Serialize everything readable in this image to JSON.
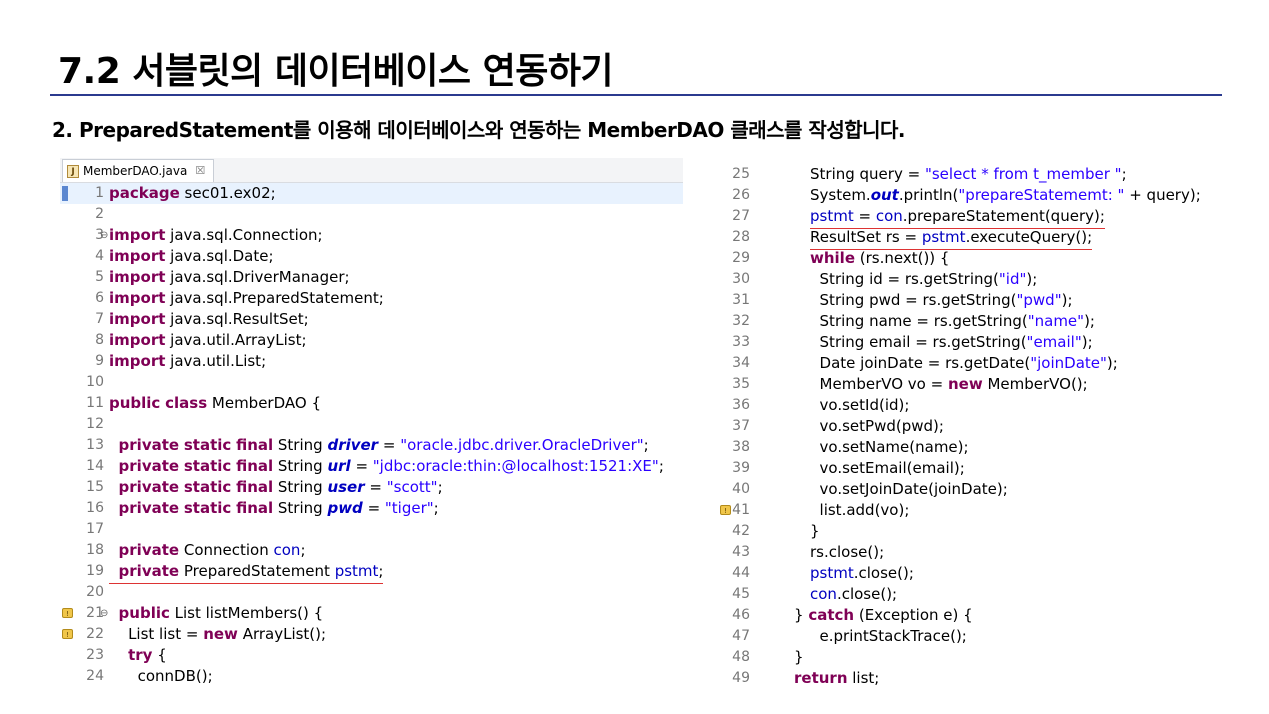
{
  "title": "7.2 서블릿의 데이터베이스 연동하기",
  "subtitle": "2. PreparedStatement를 이용해 데이터베이스와 연동하는 MemberDAO 클래스를 작성합니다.",
  "editor": {
    "tab_label": "MemberDAO.java",
    "tab_close": "☒"
  },
  "left_lines": [
    {
      "n": "1",
      "t": "package sec01.ex02;"
    },
    {
      "n": "2",
      "t": ""
    },
    {
      "n": "3",
      "t": "import java.sql.Connection;"
    },
    {
      "n": "4",
      "t": "import java.sql.Date;"
    },
    {
      "n": "5",
      "t": "import java.sql.DriverManager;"
    },
    {
      "n": "6",
      "t": "import java.sql.PreparedStatement;"
    },
    {
      "n": "7",
      "t": "import java.sql.ResultSet;"
    },
    {
      "n": "8",
      "t": "import java.util.ArrayList;"
    },
    {
      "n": "9",
      "t": "import java.util.List;"
    },
    {
      "n": "10",
      "t": ""
    },
    {
      "n": "11",
      "t": "public class MemberDAO {"
    },
    {
      "n": "12",
      "t": ""
    },
    {
      "n": "13",
      "t": "  private static final String driver = \"oracle.jdbc.driver.OracleDriver\";"
    },
    {
      "n": "14",
      "t": "  private static final String url = \"jdbc:oracle:thin:@localhost:1521:XE\";"
    },
    {
      "n": "15",
      "t": "  private static final String user = \"scott\";"
    },
    {
      "n": "16",
      "t": "  private static final String pwd = \"tiger\";"
    },
    {
      "n": "17",
      "t": ""
    },
    {
      "n": "18",
      "t": "  private Connection con;"
    },
    {
      "n": "19",
      "t": "  private PreparedStatement pstmt;"
    },
    {
      "n": "20",
      "t": ""
    },
    {
      "n": "21",
      "t": "  public List listMembers() {"
    },
    {
      "n": "22",
      "t": "    List list = new ArrayList();"
    },
    {
      "n": "23",
      "t": "    try {"
    },
    {
      "n": "24",
      "t": "      connDB();"
    }
  ],
  "right_lines": [
    {
      "n": "25",
      "t": "String query = \"select * from t_member \";"
    },
    {
      "n": "26",
      "t": "System.out.println(\"prepareStatememt: \" + query);"
    },
    {
      "n": "27",
      "t": "pstmt = con.prepareStatement(query);"
    },
    {
      "n": "28",
      "t": "ResultSet rs = pstmt.executeQuery();"
    },
    {
      "n": "29",
      "t": "while (rs.next()) {"
    },
    {
      "n": "30",
      "t": "  String id = rs.getString(\"id\");"
    },
    {
      "n": "31",
      "t": "  String pwd = rs.getString(\"pwd\");"
    },
    {
      "n": "32",
      "t": "  String name = rs.getString(\"name\");"
    },
    {
      "n": "33",
      "t": "  String email = rs.getString(\"email\");"
    },
    {
      "n": "34",
      "t": "  Date joinDate = rs.getDate(\"joinDate\");"
    },
    {
      "n": "35",
      "t": "  MemberVO vo = new MemberVO();"
    },
    {
      "n": "36",
      "t": "  vo.setId(id);"
    },
    {
      "n": "37",
      "t": "  vo.setPwd(pwd);"
    },
    {
      "n": "38",
      "t": "  vo.setName(name);"
    },
    {
      "n": "39",
      "t": "  vo.setEmail(email);"
    },
    {
      "n": "40",
      "t": "  vo.setJoinDate(joinDate);"
    },
    {
      "n": "41",
      "t": "  list.add(vo);"
    },
    {
      "n": "42",
      "t": "}"
    },
    {
      "n": "43",
      "t": "rs.close();"
    },
    {
      "n": "44",
      "t": "pstmt.close();"
    },
    {
      "n": "45",
      "t": "con.close();"
    },
    {
      "n": "46",
      "t": "} catch (Exception e) {"
    },
    {
      "n": "47",
      "t": "  e.printStackTrace();"
    },
    {
      "n": "48",
      "t": "}"
    },
    {
      "n": "49",
      "t": "return list;"
    }
  ],
  "colors": {
    "keyword": "#7f0055",
    "string": "#2a00ff",
    "field": "#0000c0",
    "title_rule": "#2b3a8f",
    "highlight_underline": "#dd3333"
  }
}
